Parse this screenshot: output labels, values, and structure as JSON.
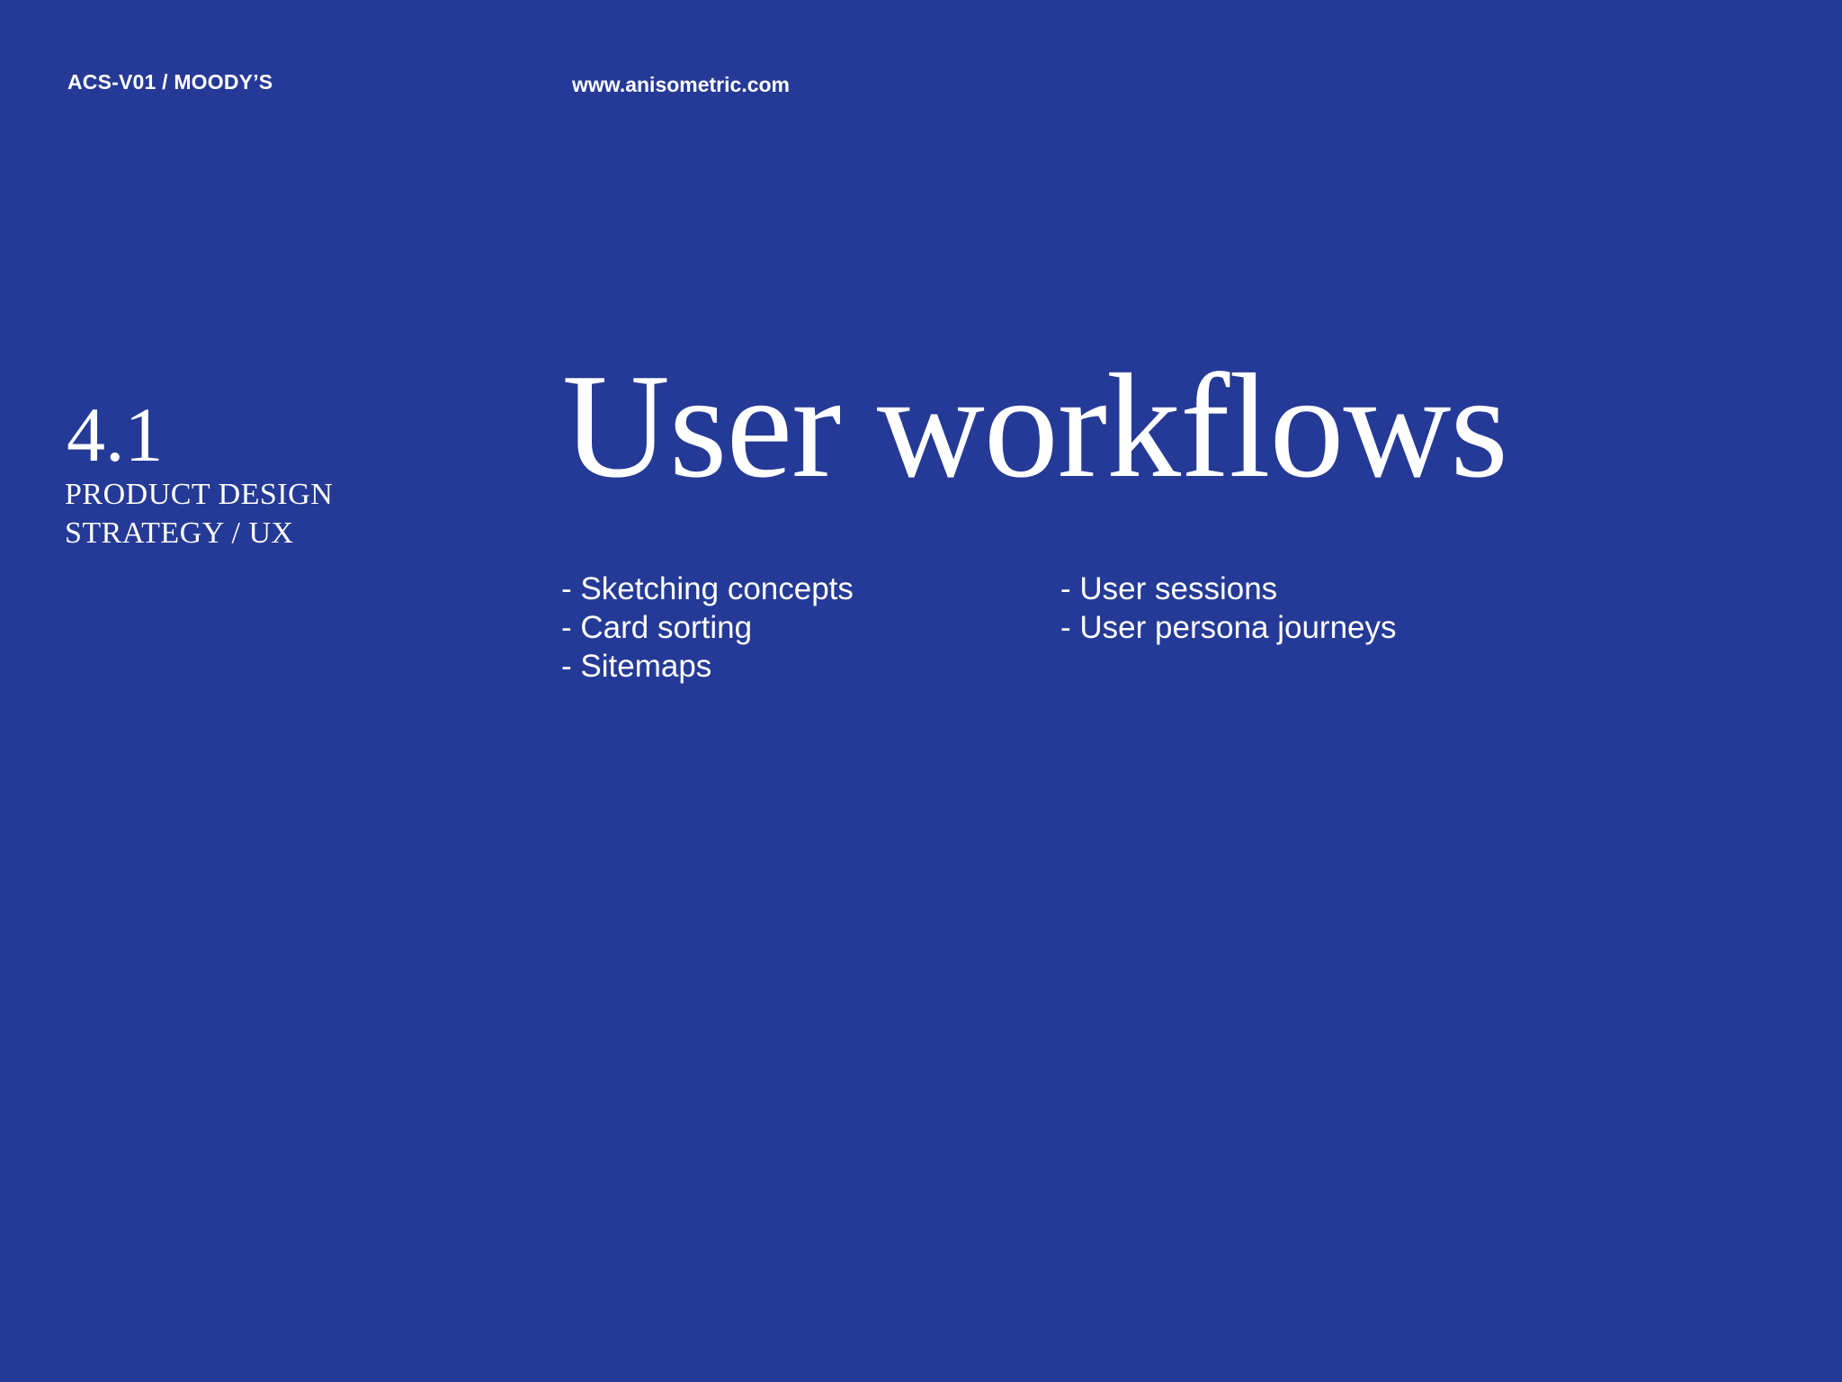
{
  "header": {
    "doc_code": "ACS-V01 / MOODY’S",
    "url": "www.anisometric.com"
  },
  "section": {
    "number": "4.1",
    "line1": "PRODUCT DESIGN",
    "line2": "STRATEGY / UX"
  },
  "title": "User workflows",
  "bullets": {
    "col1": [
      "Sketching concepts",
      "Card sorting",
      "Sitemaps"
    ],
    "col2": [
      "User sessions",
      "User persona journeys"
    ]
  },
  "colors": {
    "background": "#253a96",
    "text": "#ffffff"
  }
}
